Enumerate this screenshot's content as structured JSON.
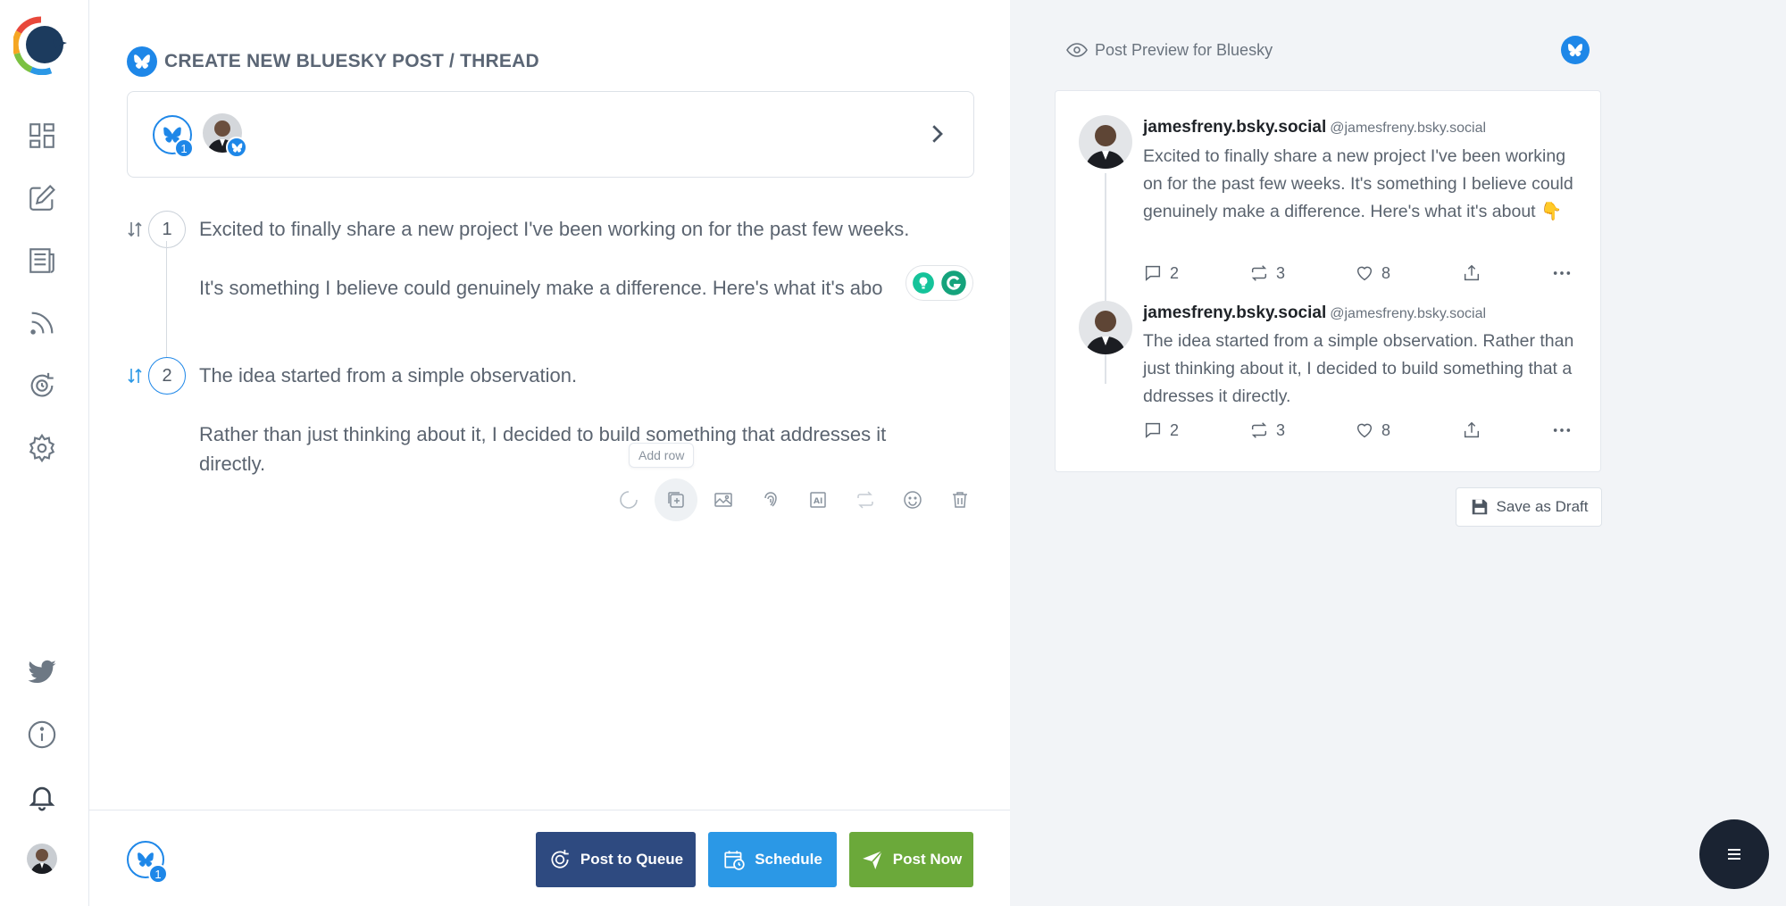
{
  "sidebar": {
    "items": [
      {
        "name": "dashboard-icon"
      },
      {
        "name": "compose-icon"
      },
      {
        "name": "posts-icon"
      },
      {
        "name": "rss-icon"
      },
      {
        "name": "recycle-icon"
      },
      {
        "name": "settings-icon"
      },
      {
        "name": "twitter-icon"
      },
      {
        "name": "info-icon"
      },
      {
        "name": "bell-icon"
      }
    ]
  },
  "composer": {
    "title": "CREATE NEW BLUESKY POST / THREAD",
    "account_count": "1",
    "posts": [
      {
        "number": "1",
        "text": "Excited to finally share a new project I've been working on for the past few weeks.\n\nIt's something I believe could genuinely make a difference. Here's what it's abo"
      },
      {
        "number": "2",
        "text": "The idea started from a simple observation.\n\nRather than just thinking about it, I decided to build something that addresses it\ndirectly."
      }
    ],
    "tooltip": "Add row",
    "toolbar_icons": [
      "loading-icon",
      "add-row-icon",
      "image-icon",
      "fingerprint-icon",
      "ai-icon",
      "retweet-icon",
      "emoji-icon",
      "trash-icon"
    ]
  },
  "footer": {
    "account_count": "1",
    "post_to_queue": "Post to Queue",
    "schedule": "Schedule",
    "post_now": "Post Now"
  },
  "preview": {
    "header": "Post Preview for Bluesky",
    "posts": [
      {
        "name": "jamesfreny.bsky.social",
        "handle": "@jamesfreny.bsky.social",
        "text": "Excited to finally share a new project I've been working on for the past few weeks. It's something I believe could genuinely make a difference. Here's what it's about 👇",
        "replies": "2",
        "reposts": "3",
        "likes": "8"
      },
      {
        "name": "jamesfreny.bsky.social",
        "handle": "@jamesfreny.bsky.social",
        "text": "The idea started from a simple observation. Rather than just thinking about it, I decided to build something that addresses it directly.",
        "replies": "2",
        "reposts": "3",
        "likes": "8"
      }
    ],
    "save_draft": "Save as Draft"
  },
  "colors": {
    "bluesky": "#1e87e8",
    "queue": "#2e4a80",
    "schedule": "#2b98e6",
    "post_now": "#6ba93a"
  }
}
